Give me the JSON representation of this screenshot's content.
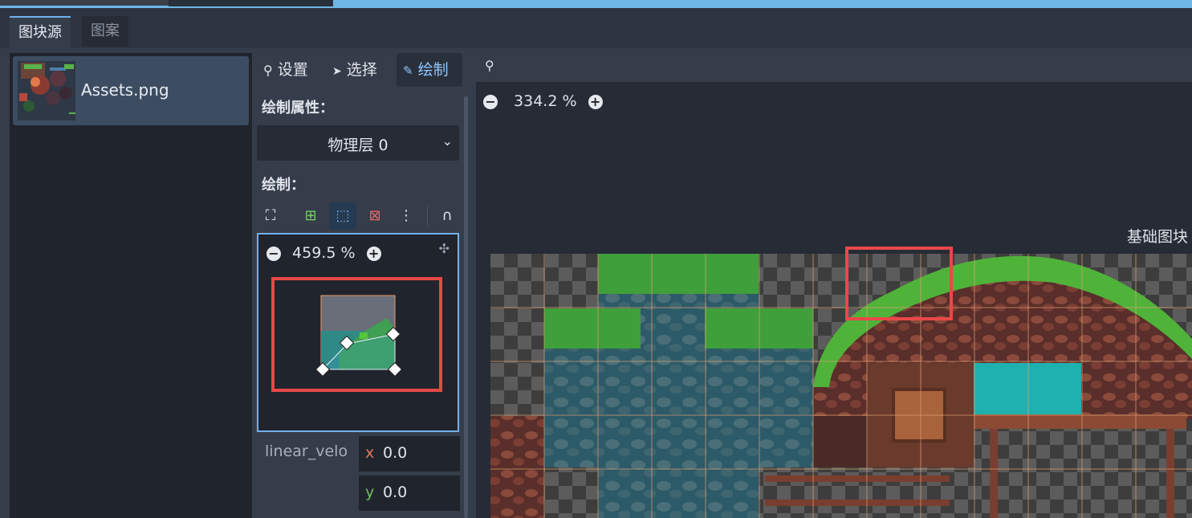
{
  "tabs": {
    "active": "图块源",
    "inactive": "图案"
  },
  "asset": {
    "label": "Assets.png"
  },
  "toolbar": {
    "settings": "设置",
    "select": "选择",
    "paint": "绘制"
  },
  "paint_properties_label": "绘制属性：",
  "dropdown": {
    "value": "物理层 0"
  },
  "paint_label": "绘制：",
  "mini_editor": {
    "zoom": "459.5 %"
  },
  "main_view": {
    "zoom": "334.2 %",
    "side_label": "基础图块"
  },
  "property": {
    "name": "linear_velo",
    "x_label": "x",
    "x_value": "0.0",
    "y_label": "y",
    "y_value": "0.0"
  },
  "colors": {
    "accent": "#70b0f0",
    "highlight": "#e94848",
    "x_axis": "#e07a5f",
    "y_axis": "#6fbf5a"
  },
  "icons": {
    "settings": "wrench-icon",
    "select": "cursor-icon",
    "paint": "brush-icon",
    "fit": "fit-view-icon",
    "add_point": "add-point-icon",
    "edit_point": "edit-point-icon",
    "remove_point": "remove-point-icon",
    "more": "more-icon",
    "snap": "snap-icon",
    "zoom_out": "zoom-out-icon",
    "zoom_in": "zoom-in-icon",
    "center": "center-view-icon",
    "pin": "pin-icon"
  }
}
